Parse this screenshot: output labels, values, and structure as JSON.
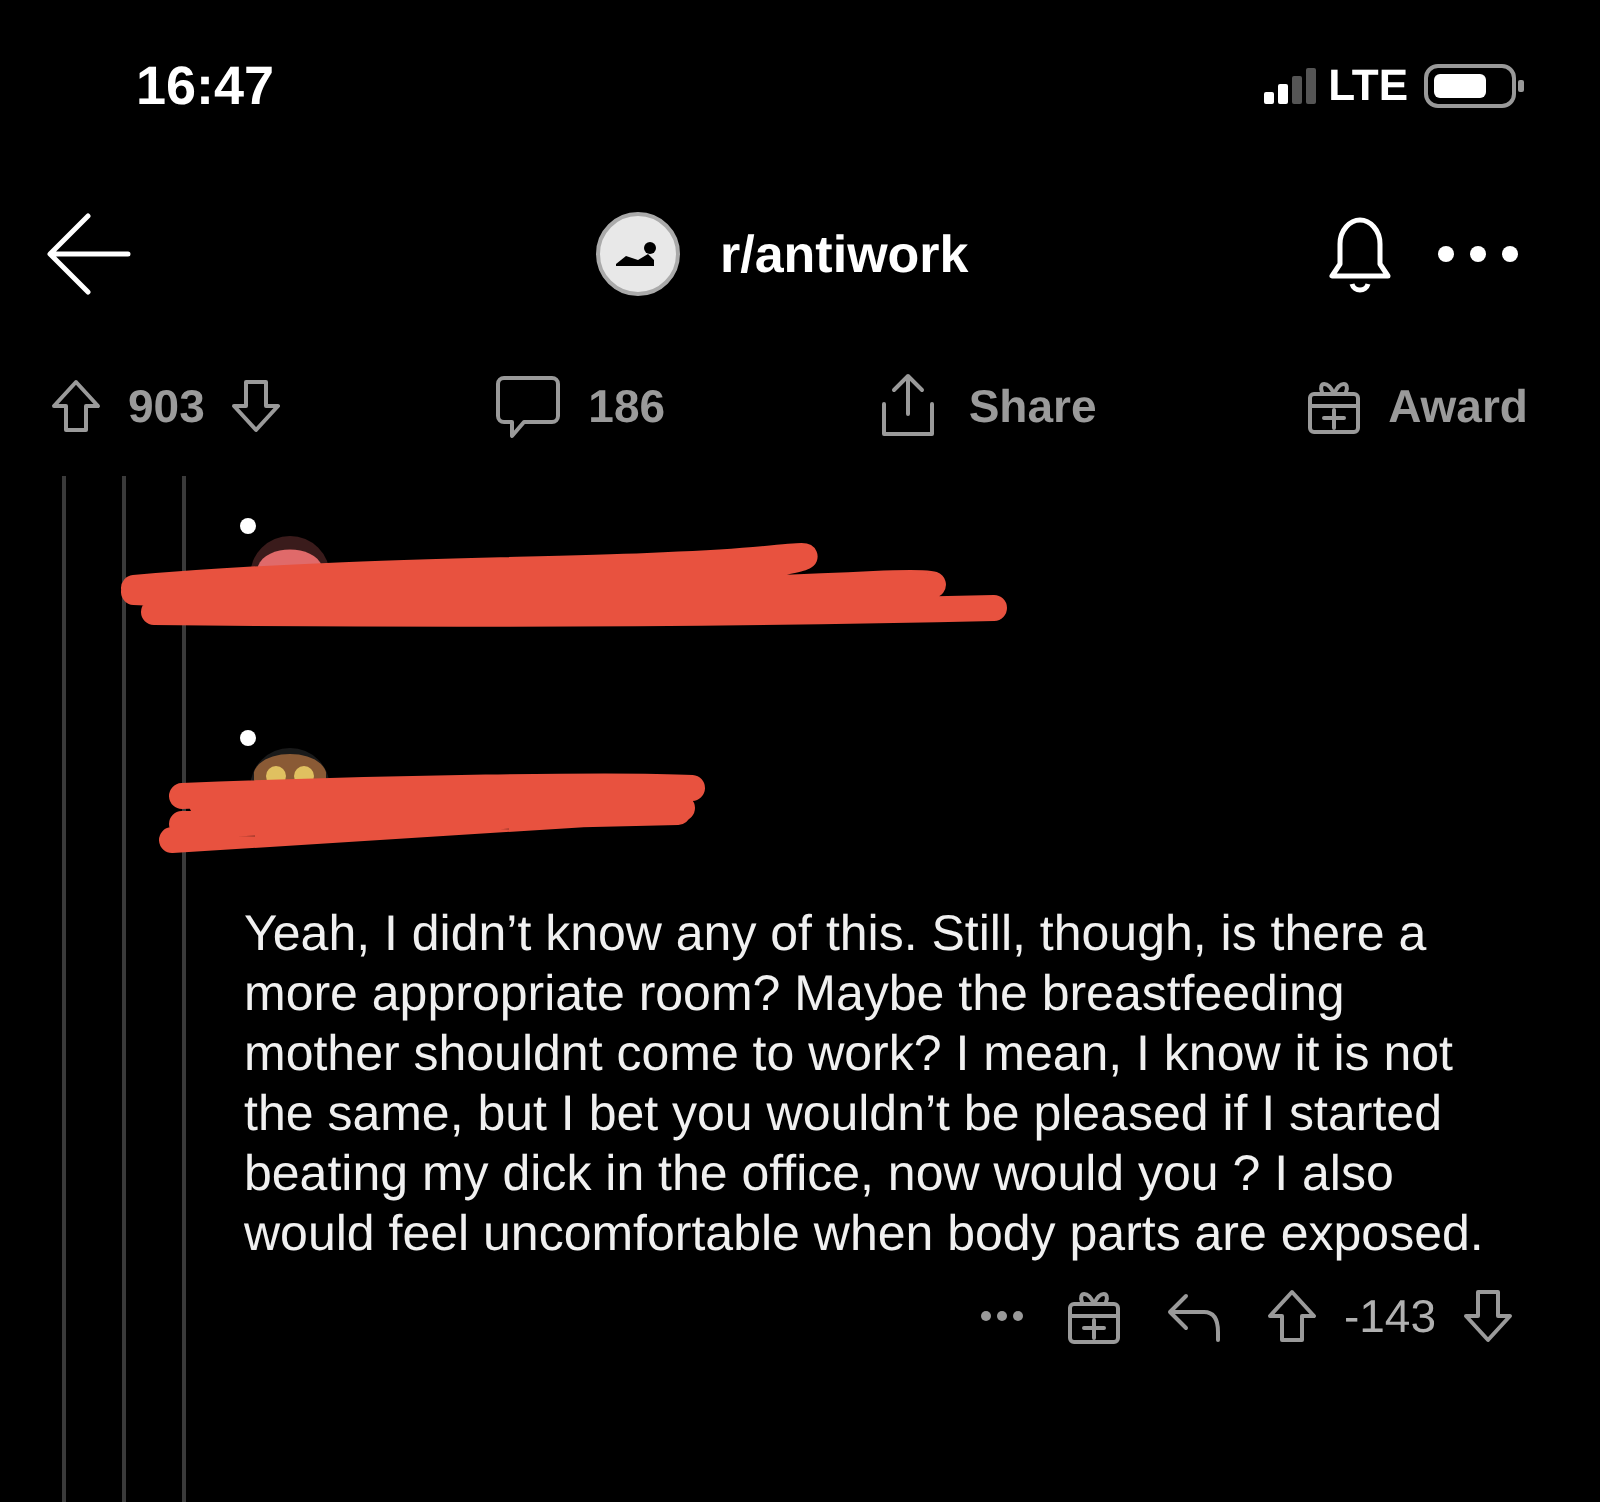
{
  "status_bar": {
    "time": "16:47",
    "network": "LTE"
  },
  "header": {
    "subreddit": "r/antiwork"
  },
  "post_actions": {
    "votes": "903",
    "comments": "186",
    "share": "Share",
    "award": "Award"
  },
  "comments": [
    {
      "kind": "header"
    },
    {
      "kind": "comment",
      "body": "Yeah, I didn’t know any of this. Still, though, is there a more appropriate room? Maybe the breastfeeding mother shouldnt come to work? I mean, I know it is not the same, but I bet you wouldn’t be pleased if I started beating my dick in the office, now would you ? I also would feel uncomfortable when body parts are exposed.",
      "votes": "-143"
    }
  ]
}
